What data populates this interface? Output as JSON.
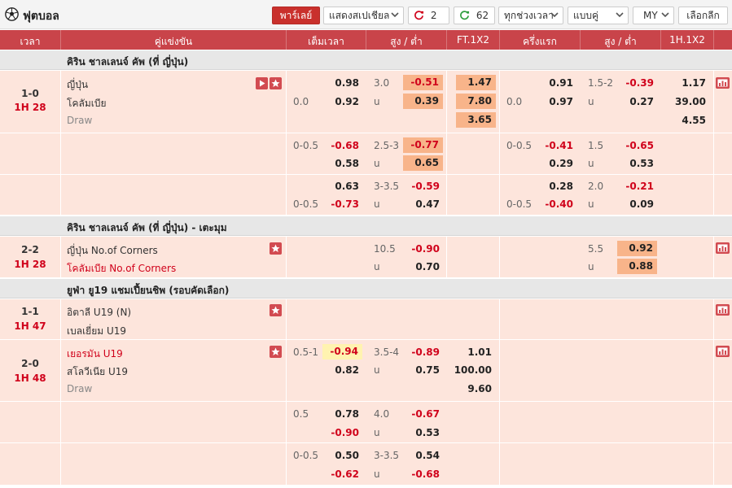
{
  "title": "ฟุตบอล",
  "toolbar": {
    "live_label": "พาร์เลย์",
    "odds_display_label": "แสดงสเปเชียล",
    "refresh_count_1": "2",
    "refresh_count_2": "62",
    "time_filter_label": "ทุกช่วงเวลา",
    "odds_type_label": "แบบคู่",
    "odds_format_label": "MY",
    "select_league_label": "เลือกลีก"
  },
  "columns": {
    "time": "เวลา",
    "match": "คู่แข่งขัน",
    "ft_hdp": "เต็มเวลา",
    "ft_ou": "สูง / ต่ำ",
    "ft_1x2": "FT.1X2",
    "h1_hdp": "ครึ่งแรก",
    "h1_ou": "สูง / ต่ำ",
    "h1_1x2": "1H.1X2"
  },
  "leagues": [
    {
      "name": "คิริน ชาลเลนจ์ คัพ (ที่ ญี่ปุ่น)"
    },
    {
      "name": "คิริน ชาลเลนจ์ คัพ (ที่ ญี่ปุ่น) - เตะมุม"
    },
    {
      "name": "ยูฟ่า ยู19 แชมเปี้ยนชิพ (รอบคัดเลือก)"
    }
  ],
  "matches": [
    {
      "score": "1-0",
      "time": "1H 28",
      "home": "ญี่ปุ่น",
      "away": "โคลัมเบีย",
      "draw": "Draw",
      "lines": [
        {
          "ft_hdp_home": "",
          "ft_hdp_away": "0.0",
          "ft_home": "0.98",
          "ft_away": "0.92",
          "ou_line": "3.0",
          "ou_u": "u",
          "ou_over": "-0.51",
          "ou_under": "0.39",
          "x_home": "1.47",
          "x_away": "7.80",
          "x_draw": "3.65",
          "h1_hdp_home": "",
          "h1_hdp_away": "0.0",
          "h1_home": "0.91",
          "h1_away": "0.97",
          "h1_ou_line": "1.5-2",
          "h1_ou_u": "u",
          "h1_over": "-0.39",
          "h1_under": "0.27",
          "h1x_home": "1.17",
          "h1x_away": "39.00",
          "h1x_draw": "4.55"
        },
        {
          "ft_hdp_home": "0-0.5",
          "ft_hdp_away": "",
          "ft_home": "-0.68",
          "ft_away": "0.58",
          "ou_line": "2.5-3",
          "ou_u": "u",
          "ou_over": "-0.77",
          "ou_under": "0.65",
          "h1_hdp_home": "0-0.5",
          "h1_hdp_away": "",
          "h1_home": "-0.41",
          "h1_away": "0.29",
          "h1_ou_line": "1.5",
          "h1_ou_u": "u",
          "h1_over": "-0.65",
          "h1_under": "0.53"
        },
        {
          "ft_hdp_home": "",
          "ft_hdp_away": "0-0.5",
          "ft_home": "0.63",
          "ft_away": "-0.73",
          "ou_line": "3-3.5",
          "ou_u": "u",
          "ou_over": "-0.59",
          "ou_under": "0.47",
          "h1_hdp_home": "",
          "h1_hdp_away": "0-0.5",
          "h1_home": "0.28",
          "h1_away": "-0.40",
          "h1_ou_line": "2.0",
          "h1_ou_u": "u",
          "h1_over": "-0.21",
          "h1_under": "0.09"
        }
      ]
    },
    {
      "score": "2-2",
      "time": "1H 28",
      "home": "ญี่ปุ่น No.of Corners",
      "away": "โคลัมเบีย No.of Corners",
      "ou_line": "10.5",
      "ou_u": "u",
      "ou_over": "-0.90",
      "ou_under": "0.70",
      "h1_ou_line": "5.5",
      "h1_ou_u": "u",
      "h1_over": "0.92",
      "h1_under": "0.88"
    },
    {
      "score": "1-1",
      "time": "1H 47",
      "home": "อิตาลี U19 (N)",
      "away": "เบลเยี่ยม U19"
    },
    {
      "score": "2-0",
      "time": "1H 48",
      "home": "เยอรมัน U19",
      "away": "สโลวีเนีย U19",
      "draw": "Draw",
      "lines": [
        {
          "ft_hdp_home": "0.5-1",
          "ft_home": "-0.94",
          "ft_away": "0.82",
          "ou_line": "3.5-4",
          "ou_u": "u",
          "ou_over": "-0.89",
          "ou_under": "0.75",
          "x_home": "1.01",
          "x_away": "100.00",
          "x_draw": "9.60"
        },
        {
          "ft_hdp_home": "0.5",
          "ft_home": "0.78",
          "ft_away": "-0.90",
          "ou_line": "4.0",
          "ou_u": "u",
          "ou_over": "-0.67",
          "ou_under": "0.53"
        },
        {
          "ft_hdp_home": "0-0.5",
          "ft_home": "0.50",
          "ft_away": "-0.62",
          "ou_line": "3-3.5",
          "ou_u": "u",
          "ou_over": "0.54",
          "ou_under": "-0.68"
        }
      ]
    }
  ]
}
